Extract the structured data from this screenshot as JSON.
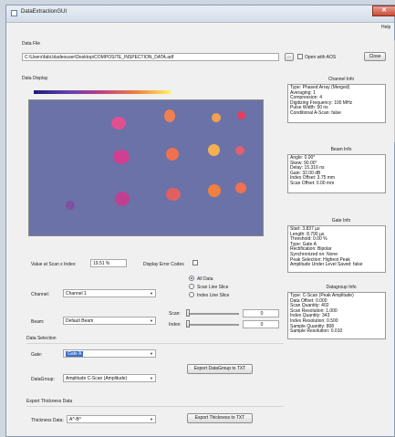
{
  "window": {
    "title": "DataExtractionGUI",
    "menu_help": "Help",
    "close_glyph": "✕"
  },
  "data_file": {
    "label": "Data File",
    "path": "C:\\Users\\fabi.bladeouser\\Desktop\\COMPOSITE_INSPECTION_DATA.adf",
    "browse_label": "...",
    "open_with_aos_label": "Open with AOS",
    "close_label": "Close"
  },
  "data_display": {
    "label": "Data Display",
    "value_label": "Value at Scan x Index:",
    "value": "19.51 %",
    "error_codes_label": "Display Error Codes"
  },
  "channel": {
    "label": "Channel:",
    "value": "Channel 1"
  },
  "beam": {
    "label": "Beam:",
    "value": "Default Beam"
  },
  "view_mode": {
    "options": [
      "All Data",
      "Scan Line Slice",
      "Index Line Slice"
    ],
    "selected": 0
  },
  "scan": {
    "label": "Scan:",
    "value": "0"
  },
  "index": {
    "label": "Index:",
    "value": "0"
  },
  "data_selection": {
    "label": "Data Selection",
    "gate_label": "Gate:",
    "gate_value": "Gate A",
    "datagroup_label": "DataGroup:",
    "datagroup_value": "Amplitude C-Scan (Amplitude)",
    "export_label": "Export DataGroup to TXT"
  },
  "thickness": {
    "label": "Export Thickness Data",
    "data_label": "Thickness Data:",
    "data_value": "A^-B^",
    "export_label": "Export Thickness to TXT"
  },
  "channel_info": {
    "title": "Channel Info",
    "lines": [
      "Type: Phased Array (Merged)",
      "Averaging: 1",
      "Compression: 4",
      "Digitizing Frequency: 100 MHz",
      "Pulse Width: 50 ns",
      "Conditional A-Scan: false"
    ]
  },
  "beam_info": {
    "title": "Beam Info",
    "lines": [
      "Angle: 0.00°",
      "Skew: 90.00°",
      "Delay: 15.316 ns",
      "Gain: 32.00 dB",
      "Index Offset: 3.75 mm",
      "Scan Offset: 0.00 mm"
    ]
  },
  "gate_info": {
    "title": "Gate Info",
    "lines": [
      "Start: 3.837 µs",
      "Length: 8.790 µs",
      "Threshold: 0.00 %",
      "Type: Gate A",
      "Rectification: Bipolar",
      "Synchronized on: None",
      "Peak Selection: Highest Peak",
      "Amplitude Under Level Saved: false"
    ]
  },
  "datagroup_info": {
    "title": "Datagroup Info",
    "lines": [
      "Type: C-Scan (Peak Amplitude)",
      "Data Offset: 0.000",
      "Scan Quantity: 402",
      "Scan Resolution: 1.000",
      "Index Quantity: 343",
      "Index Resolution: 0.500",
      "Sample Quantity: 808",
      "Sample Resolution: 0.010"
    ]
  },
  "colors": {
    "accent": "#2a5fb0",
    "heatmap_bg": "#6a72a8",
    "close_red": "#c84b3a"
  }
}
